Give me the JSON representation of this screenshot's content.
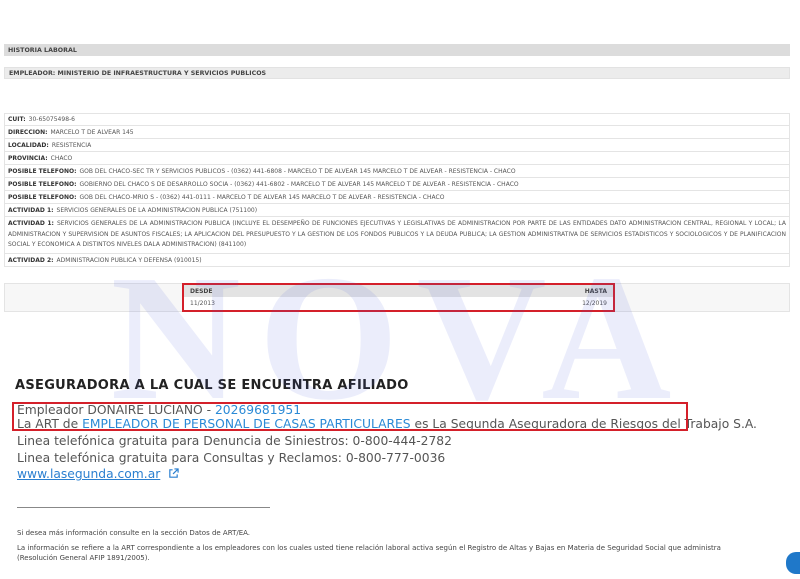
{
  "historia": {
    "section_title": "HISTORIA LABORAL",
    "employer_header": "EMPLEADOR: MINISTERIO DE INFRAESTRUCTURA Y SERVICIOS PUBLICOS",
    "rows": [
      {
        "label": "CUIT:",
        "value": "30-65075498-6"
      },
      {
        "label": "DIRECCION:",
        "value": "MARCELO T DE ALVEAR 145"
      },
      {
        "label": "LOCALIDAD:",
        "value": "RESISTENCIA"
      },
      {
        "label": "PROVINCIA:",
        "value": "CHACO"
      },
      {
        "label": "POSIBLE TELEFONO:",
        "value": "GOB DEL CHACO-SEC TR Y SERVICIOS PUBLICOS - (0362) 441-6808 - MARCELO T DE ALVEAR 145 MARCELO T DE ALVEAR - RESISTENCIA - CHACO"
      },
      {
        "label": "POSIBLE TELEFONO:",
        "value": "GOBIERNO DEL CHACO S DE DESARROLLO SOCIA - (0362) 441-6802 - MARCELO T DE ALVEAR 145 MARCELO T DE ALVEAR - RESISTENCIA - CHACO"
      },
      {
        "label": "POSIBLE TELEFONO:",
        "value": "GOB DEL CHACO-MRIO S - (0362) 441-0111 - MARCELO T DE ALVEAR 145 MARCELO T DE ALVEAR - RESISTENCIA - CHACO"
      },
      {
        "label": "ACTIVIDAD 1:",
        "value": "SERVICIOS GENERALES DE LA ADMINISTRACION PUBLICA (751100)"
      },
      {
        "label": "ACTIVIDAD 1:",
        "value": "SERVICIOS GENERALES DE LA ADMINISTRACION PUBLICA (INCLUYE EL DESEMPEÑO DE FUNCIONES EJECUTIVAS Y LEGISLATIVAS DE ADMINISTRACION POR PARTE DE LAS ENTIDADES DATO ADMINISTRACION CENTRAL, REGIONAL Y LOCAL; LA ADMINISTRACION Y SUPERVISION DE ASUNTOS FISCALES; LA APLICACION DEL PRESUPUESTO Y LA GESTION DE LOS FONDOS PUBLICOS Y LA DEUDA PUBLICA; LA GESTION ADMINISTRATIVA DE SERVICIOS ESTADISTICOS Y SOCIOLOGICOS Y DE PLANIFICACION SOCIAL Y ECONOMICA A DISTINTOS NIVELES DALA ADMINISTRACION) (841100)"
      },
      {
        "label": "ACTIVIDAD 2:",
        "value": "ADMINISTRACION PUBLICA Y DEFENSA (910015)"
      }
    ],
    "period": {
      "desde_label": "DESDE",
      "hasta_label": "HASTA",
      "desde": "11/2013",
      "hasta": "12/2019"
    }
  },
  "art": {
    "title": "ASEGURADORA A LA CUAL SE ENCUENTRA AFILIADO",
    "employer_prefix": "Empleador DONAIRE LUCIANO - ",
    "employer_cuit": "20269681951",
    "art_prefix": "La ART de ",
    "art_employer": "EMPLEADOR DE PERSONAL DE CASAS PARTICULARES",
    "art_suffix": " es La Segunda Aseguradora de Riesgos del Trabajo S.A.",
    "line_siniestros": "Linea telefónica gratuita para Denuncia de Siniestros: 0-800-444-2782",
    "line_consultas": "Linea telefónica gratuita para Consultas y Reclamos: 0-800-777-0036",
    "website": "www.lasegunda.com.ar",
    "website_icon": "external-link-icon",
    "footnote_1": "Si desea más información consulte en la sección Datos de ART/EA.",
    "footnote_2": "La información se refiere a la ART correspondiente a los empleadores con los cuales usted tiene relación laboral activa según el Registro de Altas y Bajas en Materia de Seguridad Social que administra",
    "footnote_3": "(Resolución General AFIP 1891/2005)."
  },
  "watermark": "NOVA",
  "colors": {
    "highlight": "#d4202a",
    "link": "#2a8ad6"
  }
}
